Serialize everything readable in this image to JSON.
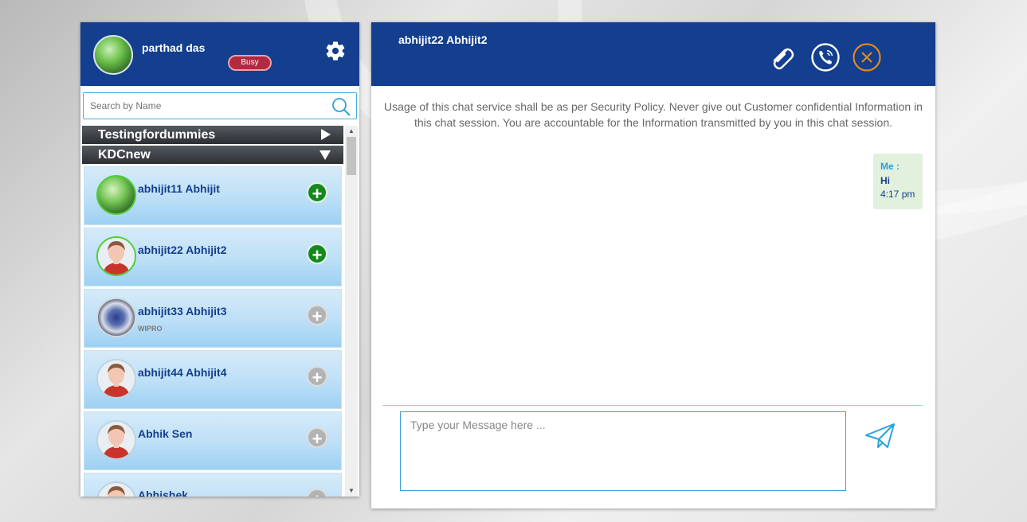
{
  "user": {
    "name": "parthad das",
    "status": "Busy"
  },
  "search": {
    "placeholder": "Search by Name"
  },
  "groups": [
    {
      "label": "Testingfordummies",
      "expanded": false
    },
    {
      "label": "KDCnew",
      "expanded": true
    }
  ],
  "contacts": [
    {
      "name": "abhijit11 Abhijit",
      "sub": "",
      "online": true,
      "avatar": "nature"
    },
    {
      "name": "abhijit22 Abhijit2",
      "sub": "",
      "online": true,
      "avatar": "person"
    },
    {
      "name": "abhijit33 Abhijit3",
      "sub": "WIPRO",
      "online": false,
      "avatar": "photo"
    },
    {
      "name": "abhijit44 Abhijit4",
      "sub": "",
      "online": false,
      "avatar": "person"
    },
    {
      "name": "Abhik Sen",
      "sub": "",
      "online": false,
      "avatar": "person"
    },
    {
      "name": "Abhishek",
      "sub": "",
      "online": false,
      "avatar": "person"
    }
  ],
  "icons": {
    "add": "+",
    "settings": "gear-icon",
    "search": "search-icon",
    "attach": "paperclip-icon",
    "call": "phone-icon",
    "close": "close-icon",
    "send": "paper-plane-icon"
  },
  "chat": {
    "title": "abhijit22 Abhijit2",
    "notice": "Usage of this chat service shall be as per Security Policy. Never give out Customer confidential Information in this chat session. You are accountable for the Information transmitted by you in this chat session.",
    "messages": [
      {
        "sender": "Me :",
        "text": "Hi",
        "time": "4:17 pm"
      }
    ],
    "input_placeholder": "Type your Message here ..."
  },
  "colors": {
    "header_blue": "#143e8e",
    "busy_red": "#b22a3f",
    "online_green": "#15891d",
    "close_orange": "#e08a1e"
  }
}
